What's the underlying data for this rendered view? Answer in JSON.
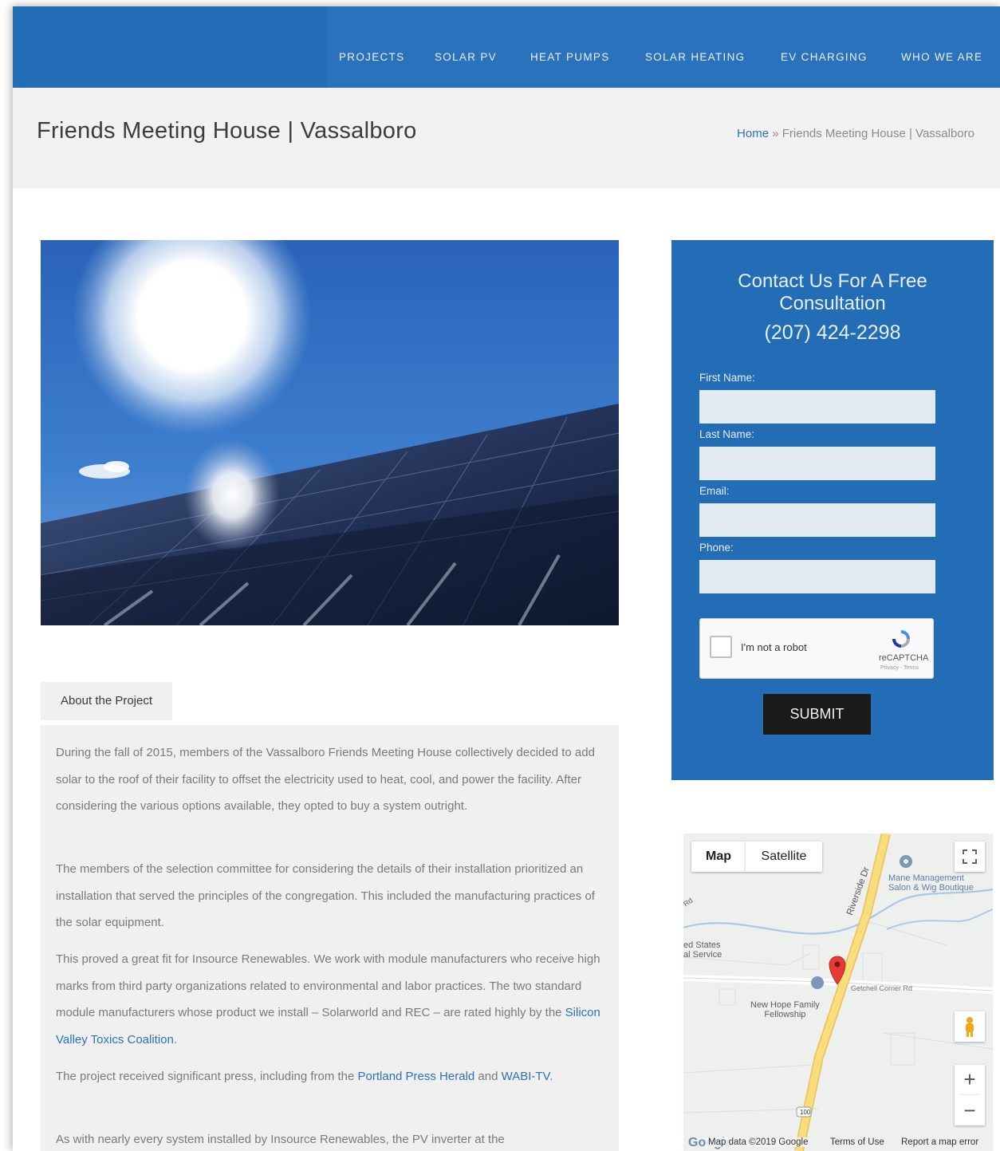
{
  "nav": {
    "items": [
      "PROJECTS",
      "SOLAR PV",
      "HEAT PUMPS",
      "SOLAR HEATING",
      "EV CHARGING",
      "WHO WE ARE"
    ]
  },
  "page": {
    "title": "Friends Meeting House | Vassalboro",
    "breadcrumb_home": "Home",
    "breadcrumb_sep": "»",
    "breadcrumb_current": "Friends Meeting House | Vassalboro"
  },
  "about": {
    "tab_label": "About the Project",
    "p1": "During the fall of 2015, members of the Vassalboro Friends Meeting House collectively decided to add solar to the roof of their facility to offset the electricity used to heat, cool, and power the facility. After considering the various options available, they opted to buy a system outright.",
    "p2": "The members of the selection committee for considering the details of their installation prioritized an installation that served the principles of the congregation. This included the manufacturing practices of the solar equipment.",
    "p3_pre": "This proved a great fit for Insource Renewables. We work with module manufacturers who receive high marks from third party organizations related to environmental and labor practices. The two standard module manufacturers whose product we install – Solarworld and REC – are rated highly by the ",
    "p3_link": "Silicon Valley Toxics Coalition",
    "p3_post": ".",
    "p4_pre": "The project received significant press, including from the ",
    "p4_link1": "Portland Press Herald",
    "p4_mid": " and ",
    "p4_link2": "WABI-TV",
    "p4_post": ".",
    "p5": "As with nearly every system installed by Insource Renewables, the PV inverter at the"
  },
  "contact": {
    "title": "Contact Us For A Free Consultation",
    "phone": "(207) 424-2298",
    "first_name_label": "First Name:",
    "last_name_label": "Last Name:",
    "email_label": "Email:",
    "phone_label": "Phone:",
    "captcha_label": "I'm not a robot",
    "captcha_brand": "reCAPTCHA",
    "captcha_sub": "Privacy - Terms",
    "submit_label": "SUBMIT"
  },
  "map": {
    "map_tab": "Map",
    "satellite_tab": "Satellite",
    "labels": {
      "business": "Mane Management\nSalon & Wig Boutique",
      "road_riverside": "Riverside Dr",
      "road_getchell": "Getchell Corner Rd",
      "postal": "ed States\nal Service",
      "church": "New Hope Family\nFellowship",
      "route": "100",
      "road_small": "Rd"
    },
    "footer_logo": "Google",
    "footer_data": "Map data ©2019 Google",
    "footer_terms": "Terms of Use",
    "footer_report": "Report a map error",
    "zoom_in": "+",
    "zoom_out": "−"
  },
  "colors": {
    "brand_blue": "#236cb6",
    "link_blue": "#2a72bc",
    "submit_bg": "#1a1a1a"
  }
}
